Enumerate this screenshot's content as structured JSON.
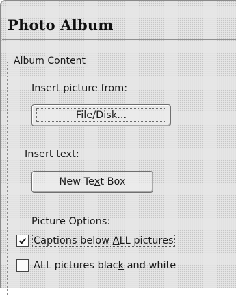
{
  "dialog": {
    "title": "Photo Album"
  },
  "album_content": {
    "group_label": "Album Content",
    "insert_picture_label": "Insert picture from:",
    "file_disk_button": {
      "pre": "",
      "key": "F",
      "post": "ile/Disk..."
    },
    "insert_text_label": "Insert text:",
    "new_text_box_button": {
      "pre": "New Te",
      "key": "x",
      "post": "t Box"
    },
    "picture_options_label": "Picture Options:",
    "captions_checkbox": {
      "pre": "Captions below ",
      "key": "A",
      "post": "LL pictures",
      "checked": true
    },
    "black_white_checkbox": {
      "pre": "ALL pictures blac",
      "key": "k",
      "post": " and white",
      "checked": false
    }
  },
  "colors": {
    "background": "#e2e2e2",
    "text": "#1a1a1a"
  }
}
